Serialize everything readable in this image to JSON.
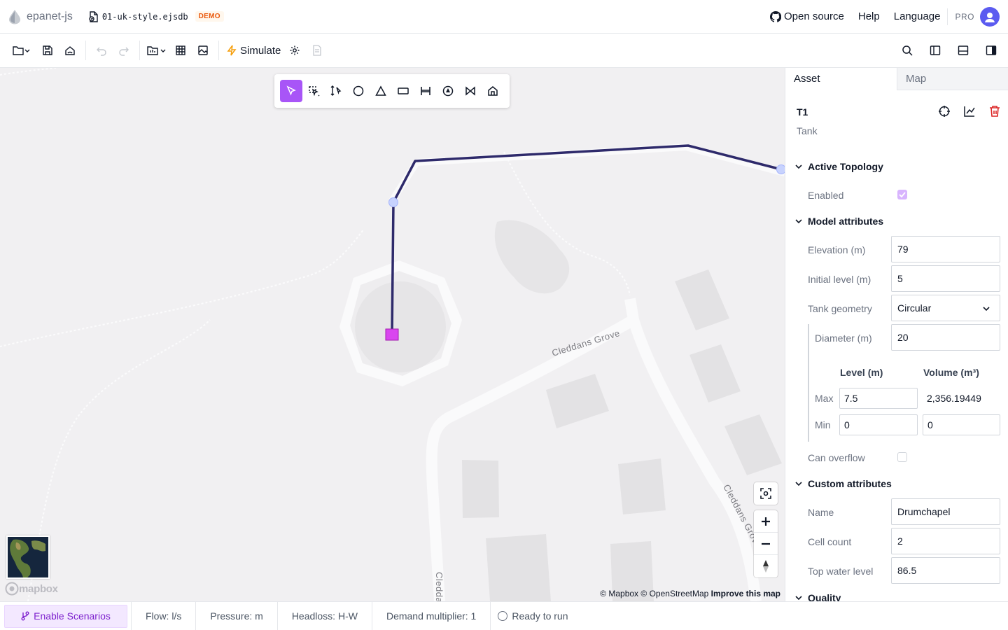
{
  "app": {
    "name": "epanet-js",
    "file": "01-uk-style.ejsdb",
    "badge": "DEMO"
  },
  "header": {
    "open_source": "Open source",
    "help": "Help",
    "language": "Language",
    "plan": "PRO"
  },
  "toolbar": {
    "simulate": "Simulate"
  },
  "map": {
    "street_labels": [
      "Cleddans Grove",
      "Cleddans Grove",
      "Cledda"
    ],
    "attribution": {
      "mapbox": "© Mapbox",
      "osm": "© OpenStreetMap",
      "improve": "Improve this map"
    },
    "logo": "mapbox"
  },
  "panel": {
    "tabs": [
      "Asset",
      "Map"
    ],
    "asset_id": "T1",
    "asset_type": "Tank",
    "sections": {
      "topology": "Active Topology",
      "model": "Model attributes",
      "custom": "Custom attributes",
      "quality": "Quality"
    },
    "enabled_label": "Enabled",
    "enabled": true,
    "model": {
      "elevation_label": "Elevation (m)",
      "elevation": "79",
      "initial_label": "Initial level (m)",
      "initial": "5",
      "geometry_label": "Tank geometry",
      "geometry": "Circular",
      "diameter_label": "Diameter (m)",
      "diameter": "20"
    },
    "levels": {
      "level_header": "Level (m)",
      "volume_header": "Volume (m³)",
      "max_label": "Max",
      "max_level": "7.5",
      "max_volume": "2,356.19449",
      "min_label": "Min",
      "min_level": "0",
      "min_volume": "0"
    },
    "overflow_label": "Can overflow",
    "overflow": false,
    "custom": {
      "name_label": "Name",
      "name": "Drumchapel",
      "cell_label": "Cell count",
      "cell": "2",
      "top_label": "Top water level",
      "top": "86.5"
    }
  },
  "statusbar": {
    "scenarios": "Enable Scenarios",
    "flow": "Flow: l/s",
    "pressure": "Pressure: m",
    "headloss": "Headloss: H-W",
    "demand": "Demand multiplier: 1",
    "run": "Ready to run"
  },
  "colors": {
    "accent": "#a855f7",
    "pipe": "#2e2a6b",
    "tank": "#d946ef",
    "junction": "#c7d2fe",
    "danger": "#dc2626"
  }
}
